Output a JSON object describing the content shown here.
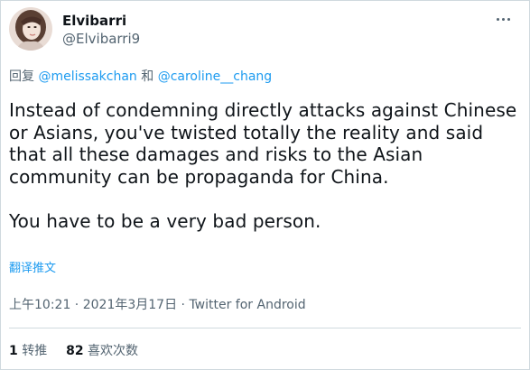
{
  "author": {
    "display_name": "Elvibarri",
    "handle": "@Elvibarri9",
    "avatar_icon": "user-avatar-photo"
  },
  "more_icon": "ellipsis-icon",
  "reply": {
    "prefix": "回复",
    "mention_1": "@melissakchan",
    "joiner": "和",
    "mention_2": "@caroline__chang"
  },
  "tweet": {
    "text": "Instead of condemning directly attacks against Chinese or Asians, you've twisted totally the reality and said that all these damages and risks to the Asian community can be propaganda for China.\n\nYou have to be a very bad person."
  },
  "translate_label": "翻译推文",
  "meta": {
    "time": "上午10:21",
    "separator": " · ",
    "date": "2021年3月17日",
    "source": "Twitter for Android"
  },
  "stats": {
    "retweets_count": "1",
    "retweets_label": "转推",
    "likes_count": "82",
    "likes_label": "喜欢次数"
  },
  "colors": {
    "link": "#1d9bf0",
    "secondary_text": "#536471",
    "primary_text": "#0f1419",
    "border": "#cfd9de"
  }
}
